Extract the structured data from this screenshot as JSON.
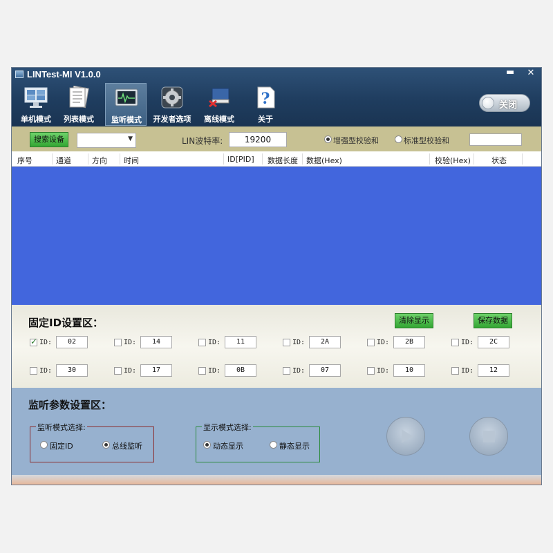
{
  "app": {
    "title": "LINTest-MI V1.0.0",
    "minimize": "▬",
    "close": "✕"
  },
  "toolbar": {
    "items": [
      {
        "label": "单机模式",
        "icon": "monitor-icon"
      },
      {
        "label": "列表模式",
        "icon": "list-document-icon"
      },
      {
        "label": "监听模式",
        "icon": "oscilloscope-icon",
        "active": true
      },
      {
        "label": "开发者选项",
        "icon": "gear-icon"
      },
      {
        "label": "离线模式",
        "icon": "book-cancel-icon"
      },
      {
        "label": "关于",
        "icon": "question-document-icon"
      }
    ],
    "toggle_label": "关闭"
  },
  "settings": {
    "search_button": "搜索设备",
    "device_select": "",
    "baud_label": "LIN波特率:",
    "baud_value": "19200",
    "checksum_enhanced": "增强型校验和",
    "checksum_standard": "标准型校验和",
    "checksum_selected": "enhanced",
    "extra_field": ""
  },
  "table": {
    "columns": [
      "序号",
      "通道",
      "方向",
      "时间",
      "ID[PID]",
      "数据长度",
      "数据(Hex)",
      "校验(Hex)",
      "状态"
    ],
    "rows": []
  },
  "fixed_id": {
    "title": "固定ID设置区：",
    "clear_button": "清除显示",
    "save_button": "保存数据",
    "id_label": "ID:",
    "entries": [
      {
        "value": "02",
        "checked": true
      },
      {
        "value": "14",
        "checked": false
      },
      {
        "value": "11",
        "checked": false
      },
      {
        "value": "2A",
        "checked": false
      },
      {
        "value": "2B",
        "checked": false
      },
      {
        "value": "2C",
        "checked": false
      },
      {
        "value": "30",
        "checked": false
      },
      {
        "value": "17",
        "checked": false
      },
      {
        "value": "0B",
        "checked": false
      },
      {
        "value": "07",
        "checked": false
      },
      {
        "value": "10",
        "checked": false
      },
      {
        "value": "12",
        "checked": false
      }
    ]
  },
  "monitor": {
    "title": "监听参数设置区：",
    "mode_group": "监听模式选择:",
    "mode_fixed": "固定ID",
    "mode_bus": "总线监听",
    "mode_selected": "bus",
    "display_group": "显示模式选择:",
    "display_dynamic": "动态显示",
    "display_static": "静态显示",
    "display_selected": "dynamic"
  },
  "colors": {
    "toolbar": "#1f3d5f",
    "settings_bar": "#c7c193",
    "table_body": "#4266dd",
    "params_panel": "#97b1cf",
    "button_green": "#4cbf4a"
  }
}
